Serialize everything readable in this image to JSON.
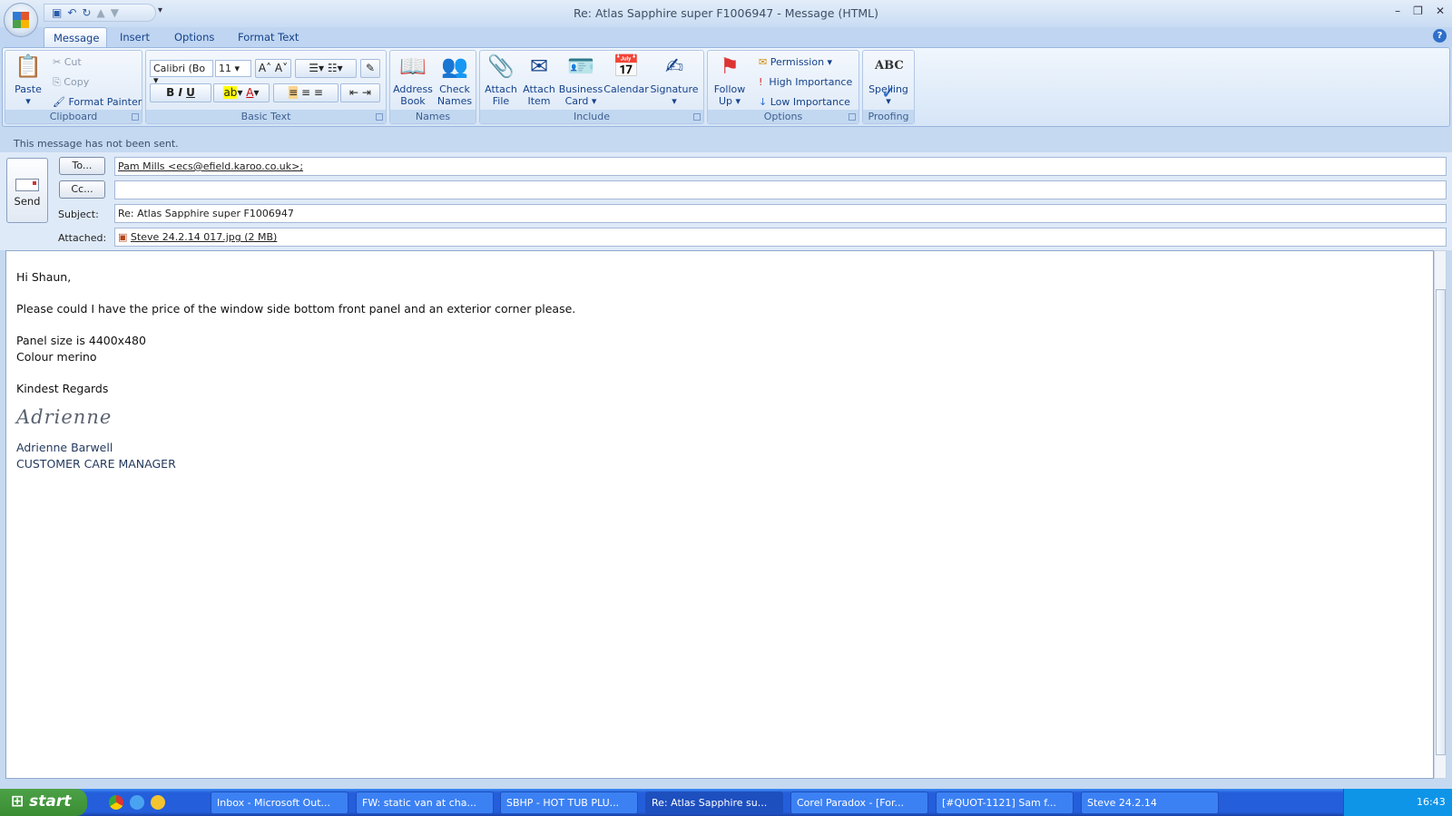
{
  "window": {
    "title": "Re: Atlas Sapphire super F1006947 - Message (HTML)"
  },
  "tabs": [
    "Message",
    "Insert",
    "Options",
    "Format Text"
  ],
  "ribbon": {
    "clipboard": {
      "label": "Clipboard",
      "paste": "Paste",
      "cut": "Cut",
      "copy": "Copy",
      "format_painter": "Format Painter"
    },
    "basic_text": {
      "label": "Basic Text",
      "font": "Calibri (Bo",
      "size": "11"
    },
    "names": {
      "label": "Names",
      "address_book": [
        "Address",
        "Book"
      ],
      "check_names": [
        "Check",
        "Names"
      ]
    },
    "include": {
      "label": "Include",
      "attach_file": [
        "Attach",
        "File"
      ],
      "attach_item": [
        "Attach",
        "Item"
      ],
      "business_card": [
        "Business",
        "Card"
      ],
      "calendar": "Calendar",
      "signature": "Signature"
    },
    "options": {
      "label": "Options",
      "follow_up": [
        "Follow",
        "Up"
      ],
      "permission": "Permission",
      "high": "High Importance",
      "low": "Low Importance"
    },
    "proofing": {
      "label": "Proofing",
      "spelling": "Spelling",
      "abc": "ABC"
    }
  },
  "infobar": "This message has not been sent.",
  "header": {
    "send": "Send",
    "to_btn": "To...",
    "cc_btn": "Cc...",
    "to": "Pam Mills <ecs@efield.karoo.co.uk>;",
    "cc": "",
    "subject_label": "Subject:",
    "subject": "Re: Atlas Sapphire super F1006947",
    "attached_label": "Attached:",
    "attachment": "Steve 24.2.14 017.jpg (2 MB)"
  },
  "body": {
    "greeting": "Hi Shaun,",
    "line1": "Please could I have the price of the window side bottom front panel and an exterior corner please.",
    "size": "Panel size is 4400x480",
    "colour": "Colour merino",
    "regards": "Kindest Regards",
    "signature": "Adrienne",
    "name": "Adrienne Barwell",
    "role": "CUSTOMER CARE MANAGER"
  },
  "taskbar": {
    "start": "start",
    "items": [
      "Inbox - Microsoft Out...",
      "FW: static van at cha...",
      "SBHP - HOT TUB PLU...",
      "Re: Atlas Sapphire su...",
      "Corel Paradox - [For...",
      "[#QUOT-1121] Sam f...",
      "Steve 24.2.14"
    ],
    "clock": "16:43"
  }
}
